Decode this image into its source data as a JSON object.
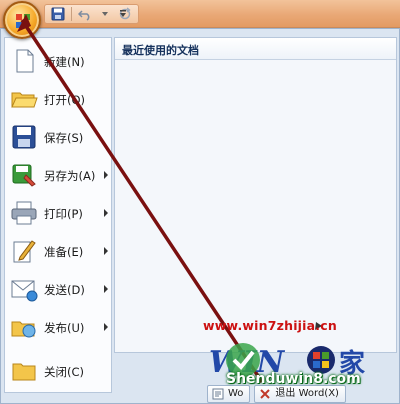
{
  "titlebar": {
    "office_button_icon": "office-logo-icon",
    "qat": {
      "save_icon": "floppy-disk-icon",
      "undo_icon": "undo-arrow-icon",
      "redo_icon": "redo-arrow-icon",
      "customize_icon": "chevron-down-icon"
    }
  },
  "menu": {
    "items": [
      {
        "label": "新建(N)",
        "icon": "new-document-icon",
        "submenu": false
      },
      {
        "label": "打开(O)",
        "icon": "open-folder-icon",
        "submenu": false
      },
      {
        "label": "保存(S)",
        "icon": "floppy-disk-icon",
        "submenu": false
      },
      {
        "label": "另存为(A)",
        "icon": "save-as-icon",
        "submenu": true
      },
      {
        "label": "打印(P)",
        "icon": "printer-icon",
        "submenu": true
      },
      {
        "label": "准备(E)",
        "icon": "prepare-pen-icon",
        "submenu": true
      },
      {
        "label": "发送(D)",
        "icon": "send-mail-icon",
        "submenu": true
      },
      {
        "label": "发布(U)",
        "icon": "publish-folder-icon",
        "submenu": true
      },
      {
        "label": "关闭(C)",
        "icon": "close-folder-icon",
        "submenu": false
      }
    ],
    "recent": {
      "heading": "最近使用的文档"
    },
    "bottom_buttons": [
      {
        "label": "Wo",
        "icon": "word-options-icon"
      },
      {
        "label": "退出 Word(X)",
        "icon": "exit-icon"
      }
    ]
  },
  "watermark": {
    "url": "www.win7zhijia.cn",
    "site": "Shenduwin8.com",
    "logo_icon": "windows-logo-icon"
  },
  "colors": {
    "accent_orange": "#e9a876",
    "menu_bg": "#dbe5f1",
    "watermark_red": "#cc1111",
    "pointer_line": "#7a1010"
  }
}
